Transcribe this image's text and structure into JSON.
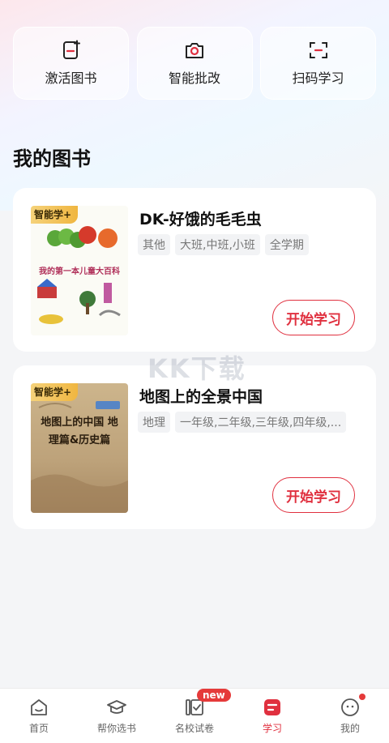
{
  "quick_actions": [
    {
      "label": "激活图书",
      "icon": "activate-book-icon"
    },
    {
      "label": "智能批改",
      "icon": "camera-icon"
    },
    {
      "label": "扫码学习",
      "icon": "scan-icon"
    }
  ],
  "section_title": "我的图书",
  "books": [
    {
      "title": "DK-好饿的毛毛虫",
      "badge": "智能学+",
      "tags": [
        "其他",
        "大班,中班,小班",
        "全学期"
      ],
      "cover_text": "我的第一本儿童大百科",
      "button": "开始学习"
    },
    {
      "title": "地图上的全景中国",
      "badge": "智能学+",
      "tags": [
        "地理",
        "一年级,二年级,三年级,四年级,..."
      ],
      "cover_text": "地图上的中国 地理篇&历史篇",
      "button": "开始学习"
    }
  ],
  "watermark": "KK下载",
  "tabbar": [
    {
      "label": "首页",
      "icon": "home-icon",
      "active": false
    },
    {
      "label": "帮你选书",
      "icon": "graduation-cap-icon",
      "active": false
    },
    {
      "label": "名校试卷",
      "icon": "exam-paper-icon",
      "active": false,
      "badge": "new"
    },
    {
      "label": "学习",
      "icon": "study-icon",
      "active": true
    },
    {
      "label": "我的",
      "icon": "profile-icon",
      "active": false
    }
  ],
  "colors": {
    "accent": "#e0303f",
    "badge": "#e53a3a"
  }
}
